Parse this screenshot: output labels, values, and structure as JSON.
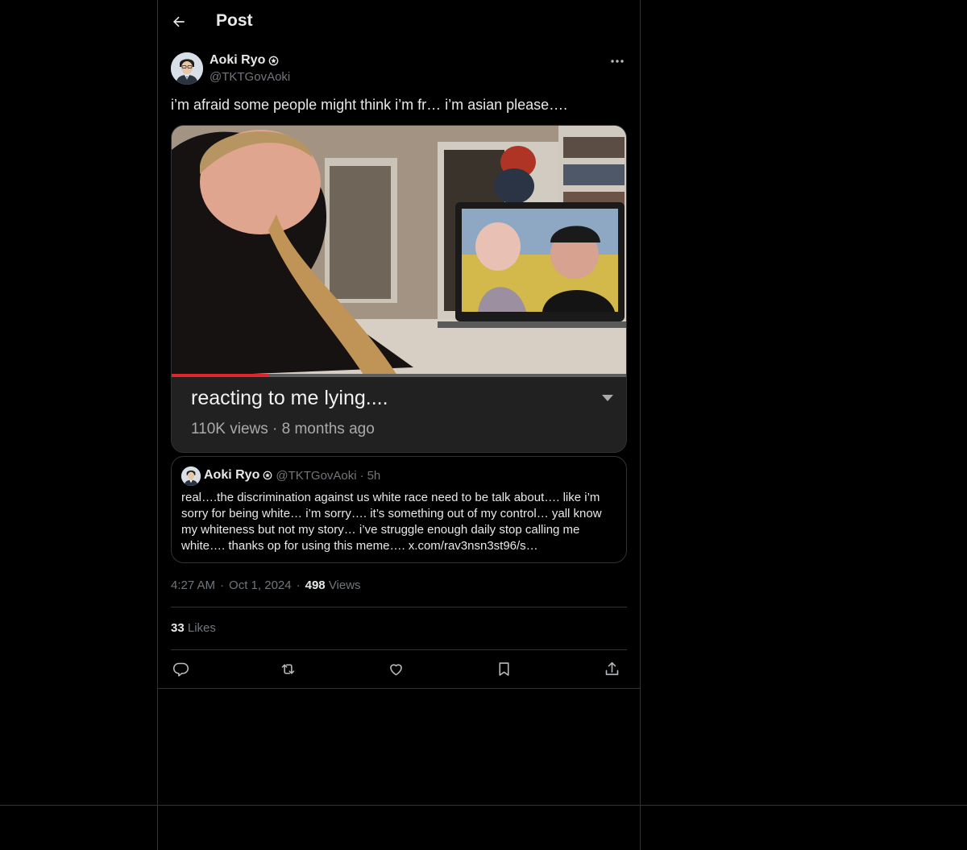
{
  "header": {
    "title": "Post",
    "back_icon": "arrow-left-icon"
  },
  "post": {
    "author_name": "Aoki Ryo",
    "author_handle": "@TKTGovAoki",
    "text": "i’m afraid some people might think i’m fr… i’m asian please….",
    "media": {
      "video_title": "reacting to me lying....",
      "video_meta": "110K views · 8 months ago"
    },
    "quote": {
      "author_name": "Aoki Ryo",
      "author_handle": "@TKTGovAoki",
      "separator": "·",
      "time": "5h",
      "text": "real….the discrimination against us white race need to be talk about…. like i’m sorry for being white… i’m sorry…. it’s something out of my control… yall know my whiteness but not my story… i’ve struggle enough daily stop calling me white…. thanks op for using this meme…. x.com/rav3nsn3st96/s…"
    },
    "time": "4:27 AM",
    "date": "Oct 1, 2024",
    "dot": "·",
    "views_count": "498",
    "views_label": "Views",
    "likes_count": "33",
    "likes_label": "Likes"
  },
  "actions": [
    "reply-icon",
    "repost-icon",
    "like-icon",
    "bookmark-icon",
    "share-icon"
  ],
  "colors": {
    "background": "#000000",
    "text": "#e7e9ea",
    "muted": "#71767b",
    "border": "#2f3336"
  }
}
